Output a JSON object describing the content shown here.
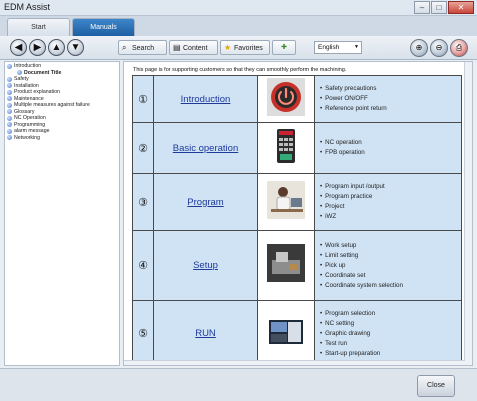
{
  "window": {
    "title": "EDM Assist",
    "minimize_glyph": "–",
    "maximize_glyph": "□",
    "close_glyph": "✕"
  },
  "tabs": [
    {
      "label": "Start"
    },
    {
      "label": "Manuals"
    }
  ],
  "toolbar": {
    "search_label": "Search",
    "content_label": "Content",
    "favorites_label": "Favorites",
    "language": "English",
    "nav_icons": [
      "back-icon",
      "forward-icon",
      "up-icon",
      "down-icon"
    ]
  },
  "sidebar": {
    "items": [
      {
        "label": "Introduction"
      },
      {
        "label": "Document Title",
        "child": true
      },
      {
        "label": "Safety"
      },
      {
        "label": "Installation"
      },
      {
        "label": "Product explanation"
      },
      {
        "label": "Maintenance"
      },
      {
        "label": "Multiple measures against failure"
      },
      {
        "label": "Glossary"
      },
      {
        "label": "NC Operation"
      },
      {
        "label": "Programming"
      },
      {
        "label": "alarm message"
      },
      {
        "label": "Networking"
      }
    ]
  },
  "content": {
    "intro": "This page is for supporting customers so that they can smoothly perform the machining.",
    "rows": [
      {
        "num": "①",
        "title": "Introduction",
        "image": "power-button-image",
        "bullets": [
          "Safety precautions",
          "Power ON/OFF",
          "Reference point return"
        ]
      },
      {
        "num": "②",
        "title": "Basic operation",
        "image": "remote-controller-image",
        "bullets": [
          "NC operation",
          "FPB operation"
        ]
      },
      {
        "num": "③",
        "title": "Program",
        "image": "operator-at-desk-image",
        "bullets": [
          "Program input /output",
          "Program practice",
          "Project",
          "iWZ"
        ]
      },
      {
        "num": "④",
        "title": "Setup",
        "image": "workpiece-setup-image",
        "bullets": [
          "Work setup",
          "Limit setting",
          "Pick up",
          "Coordinate set",
          "Coordinate system selection"
        ]
      },
      {
        "num": "⑤",
        "title": "RUN",
        "image": "run-screen-image",
        "bullets": [
          "Program selection",
          "NC setting",
          "Graphic drawing",
          "Test run",
          "Start-up preparation"
        ]
      }
    ]
  },
  "footer": {
    "close_label": "Close"
  },
  "colors": {
    "tab_active": "#1f5fa3",
    "row_bg": "#cfe3f5",
    "link": "#1f3a9a"
  }
}
